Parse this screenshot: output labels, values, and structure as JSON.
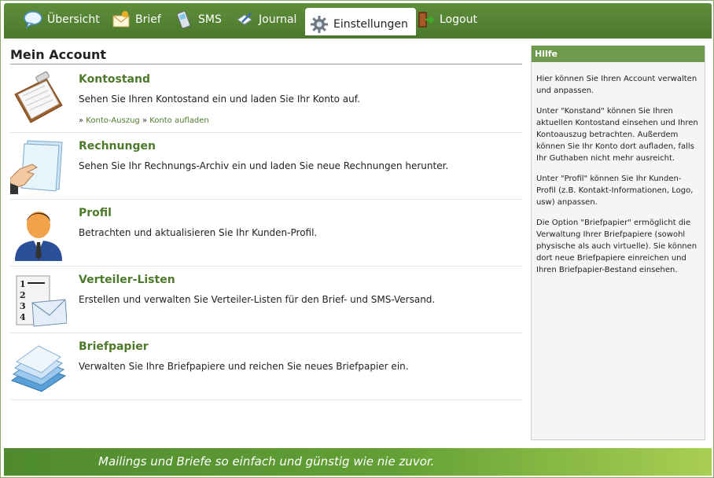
{
  "nav": {
    "tabs": [
      {
        "label": "Übersicht",
        "icon": "speech-bubble-icon"
      },
      {
        "label": "Brief",
        "icon": "envelope-icon"
      },
      {
        "label": "SMS",
        "icon": "mobile-phone-icon"
      },
      {
        "label": "Journal",
        "icon": "journal-pen-icon"
      },
      {
        "label": "Einstellungen",
        "icon": "gear-icon"
      },
      {
        "label": "Logout",
        "icon": "exit-door-icon"
      }
    ],
    "active_tab": "Einstellungen"
  },
  "main": {
    "title": "Mein Account",
    "items": [
      {
        "title": "Kontostand",
        "description": "Sehen Sie Ihren Kontostand ein und laden Sie Ihr Konto auf.",
        "icon": "clipboard-icon",
        "links": [
          "Konto-Auszug",
          "Konto aufladen"
        ]
      },
      {
        "title": "Rechnungen",
        "description": "Sehen Sie Ihr Rechnungs-Archiv ein und laden Sie neue Rechnungen herunter.",
        "icon": "invoice-hand-icon"
      },
      {
        "title": "Profil",
        "description": "Betrachten und aktualisieren Sie Ihr Kunden-Profil.",
        "icon": "user-profile-icon"
      },
      {
        "title": "Verteiler-Listen",
        "description": "Erstellen und verwalten Sie Verteiler-Listen für den Brief- und SMS-Versand.",
        "icon": "numbered-list-envelope-icon",
        "list_numbers": [
          "1",
          "2",
          "3",
          "4"
        ]
      },
      {
        "title": "Briefpapier",
        "description": "Verwalten Sie Ihre Briefpapiere und reichen Sie neues Briefpapier ein.",
        "icon": "paper-stack-icon"
      }
    ]
  },
  "help": {
    "title": "Hilfe",
    "paragraphs": [
      "Hier können Sie Ihren Account verwalten und anpassen.",
      "Unter \"Konstand\" können Sie Ihren aktuellen Kontostand einsehen und Ihren Kontoauszug betrachten. Außerdem können Sie Ihr Konto dort aufladen, falls Ihr Guthaben nicht mehr ausreicht.",
      "Unter \"Profil\" können Sie Ihr Kunden-Profil (z.B. Kontakt-Informationen, Logo, usw) anpassen.",
      "Die Option \"Briefpapier\" ermöglicht die Verwaltung Ihrer Briefpapiere (sowohl physische als auch virtuelle). Sie können dort neue Briefpapiere einreichen und Ihren Briefpapier-Bestand einsehen."
    ]
  },
  "footer": {
    "slogan": "Mailings und Briefe so einfach und günstig wie nie zuvor."
  },
  "colors": {
    "nav_green": "#4c7a2c",
    "title_green": "#4d7a2a",
    "help_header": "#6e9a4e"
  }
}
